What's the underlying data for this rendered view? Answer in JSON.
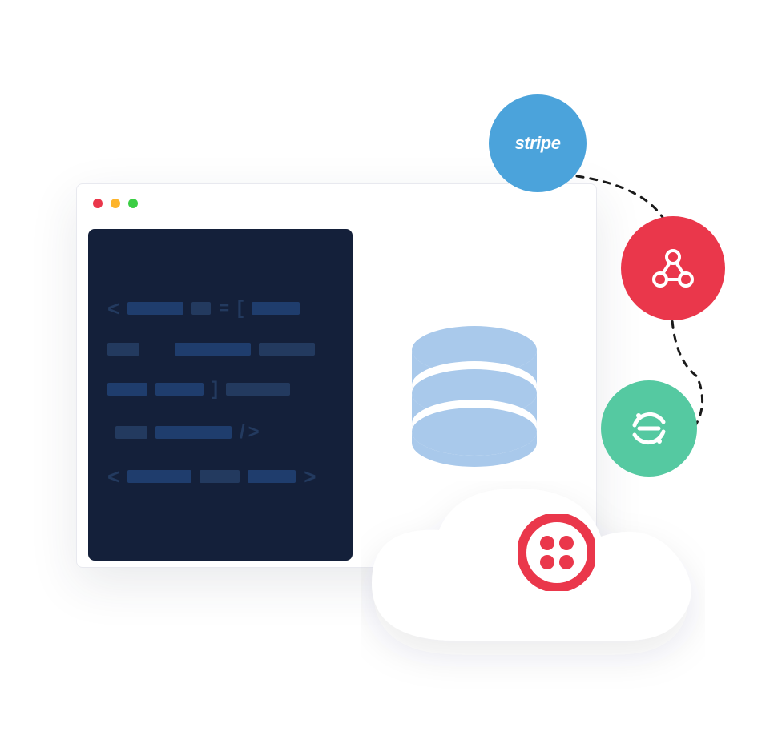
{
  "illustration": {
    "bubbles": {
      "stripe": {
        "label": "stripe",
        "color": "#4ba3db"
      },
      "webhook": {
        "name": "webhook-icon",
        "color": "#ea374b"
      },
      "segment": {
        "name": "segment-icon",
        "color": "#55c9a1"
      }
    },
    "cloud": {
      "name": "cloud",
      "twilio": {
        "name": "twilio-icon",
        "color": "#ea374b"
      }
    },
    "browser": {
      "traffic": [
        "red",
        "yellow",
        "green"
      ],
      "code_blocks": "decorative",
      "database": {
        "name": "database-icon",
        "color": "#a9c9eb"
      }
    }
  }
}
